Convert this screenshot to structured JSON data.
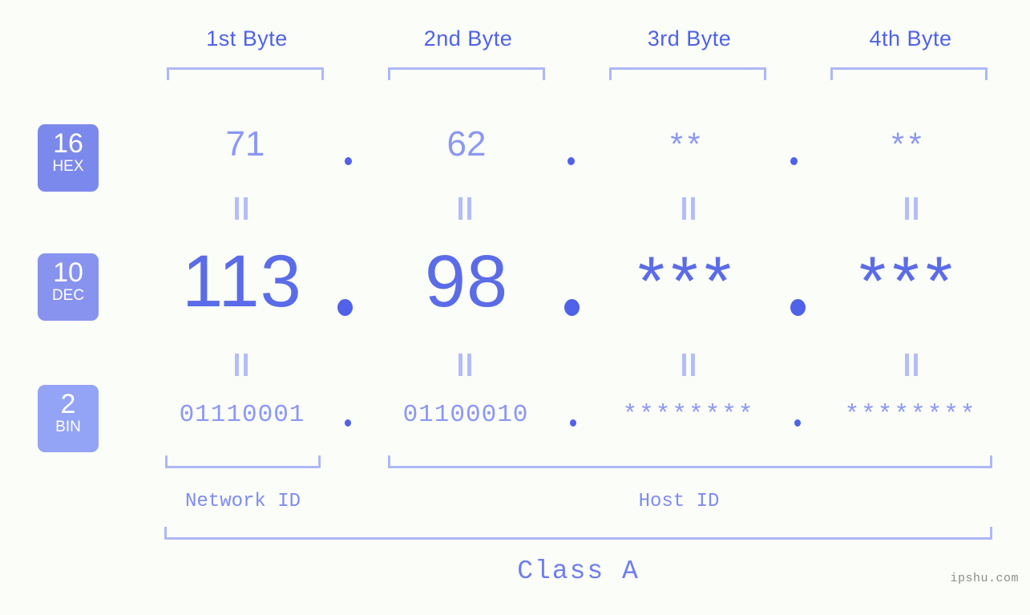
{
  "page": {
    "background_color": "#fbfdf8",
    "accent_color": "#4f62e8",
    "light_accent_color": "#aeb8f7",
    "watermark": "ipshu.com"
  },
  "byte_headers": [
    {
      "label": "1st Byte"
    },
    {
      "label": "2nd Byte"
    },
    {
      "label": "3rd Byte"
    },
    {
      "label": "4th Byte"
    }
  ],
  "radix_badges": [
    {
      "number": "16",
      "name": "HEX",
      "color": "#7b88ec"
    },
    {
      "number": "10",
      "name": "DEC",
      "color": "#8793ee"
    },
    {
      "number": "2",
      "name": "BIN",
      "color": "#93a3f5"
    }
  ],
  "rows": {
    "hex": {
      "radix": "16",
      "radix_name": "HEX",
      "values": [
        "71",
        "62",
        "**",
        "**"
      ],
      "separator": "."
    },
    "dec": {
      "radix": "10",
      "radix_name": "DEC",
      "values": [
        "113",
        "98",
        "***",
        "***"
      ],
      "separator": "."
    },
    "bin": {
      "radix": "2",
      "radix_name": "BIN",
      "values": [
        "01110001",
        "01100010",
        "********",
        "********"
      ],
      "separator": "."
    }
  },
  "equality_marks": {
    "symbol": "=",
    "count_per_gap": 4,
    "gaps": 2
  },
  "id_spans": [
    {
      "label": "Network ID"
    },
    {
      "label": "Host ID"
    }
  ],
  "class_span": {
    "label": "Class A"
  }
}
